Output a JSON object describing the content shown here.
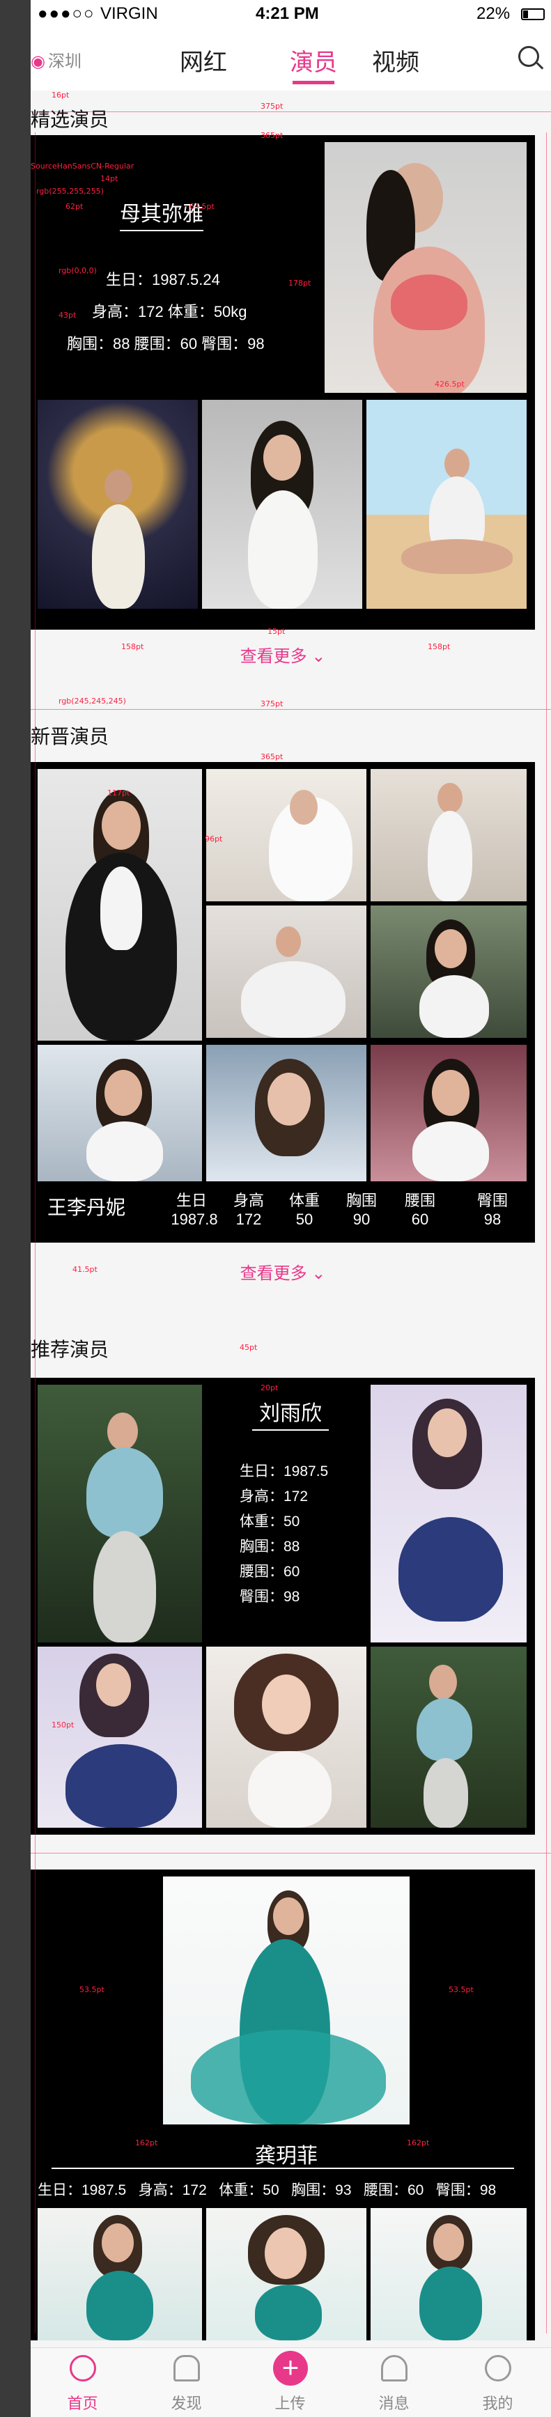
{
  "status_bar": {
    "signal": "●●●○○",
    "carrier": "VIRGIN",
    "time": "4:21 PM",
    "battery": "22%"
  },
  "top_nav": {
    "city": "深圳",
    "tabs": [
      "网红",
      "演员",
      "视频"
    ],
    "active_tab": "演员"
  },
  "featured": {
    "section_title": "精选演员",
    "name": "母其弥雅",
    "birthday": "生日：1987.5.24",
    "height_weight": "身高：172 体重：50kg",
    "measurements": "胸围：88 腰围：60 臀围：98",
    "more": "查看更多"
  },
  "new_actors": {
    "section_title": "新晋演员",
    "name": "王李丹妮",
    "stats_labels": [
      "生日",
      "身高",
      "体重",
      "胸围",
      "腰围",
      "臀围"
    ],
    "stats_values": [
      "1987.8",
      "172",
      "50",
      "90",
      "60",
      "98"
    ],
    "more": "查看更多"
  },
  "recommended": {
    "section_title": "推荐演员",
    "profile1": {
      "name": "刘雨欣",
      "lines": [
        "生日：1987.5",
        "身高：172",
        "体重：50",
        "胸围：88",
        "腰围：60",
        "臀围：98"
      ]
    },
    "profile2": {
      "name": "龚玥菲",
      "stats": "生日：1987.5   身高：172   体重：50   胸围：93   腰围：60   臀围：98"
    }
  },
  "bottom_bar": {
    "items": [
      "首页",
      "发现",
      "上传",
      "消息",
      "我的"
    ],
    "active": "首页"
  },
  "annotations": {
    "w16": "16pt",
    "w375": "375pt",
    "w365": "365pt",
    "w1": "1pt",
    "font_note": "SourceHanSansCN-Regular",
    "font14": "14pt",
    "color_white": "rgb(255,255,255)",
    "w62": "62pt",
    "w645": "64.5pt",
    "w62b": "62pt",
    "w4": "4pt",
    "w10": "10pt",
    "color_black": "rgb(0,0,0)",
    "w43": "43pt",
    "w178": "178pt",
    "w4265": "426.5pt",
    "w15": "15pt",
    "w158": "158pt",
    "color_grey": "rgb(255,255,255)",
    "color_bg": "rgb(245,245,245)",
    "w117": "117pt",
    "w96": "96pt",
    "w415": "41.5pt",
    "w45": "45pt",
    "w20": "20pt",
    "w535": "53.5pt",
    "w162": "162pt",
    "w2": "2pt",
    "w150": "150pt"
  },
  "colors": {
    "accent": "#e8388a",
    "black": "#000000",
    "bg": "#f5f5f5"
  }
}
